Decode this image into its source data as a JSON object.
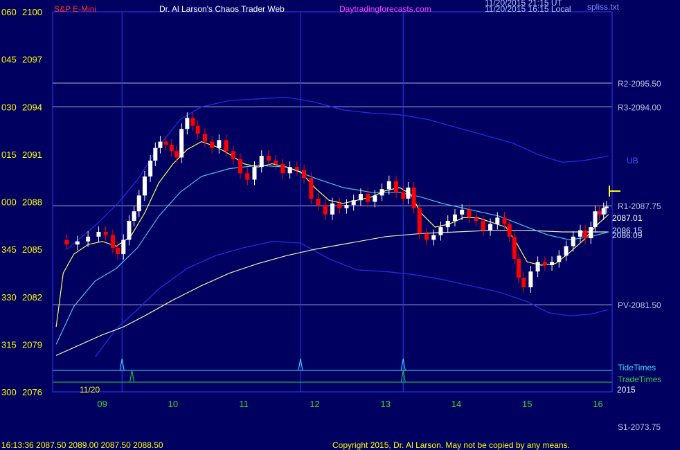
{
  "header": {
    "symbol": "S&P E-Mini",
    "title": "Dr. Al Larson's Chaos Trader Web",
    "site": "Daytradingforecasts.com",
    "stamp1": "11/20/2015 21:15 UT",
    "stamp2": "11/20/2015 16:15 Local",
    "file": "spliss.txt"
  },
  "footer": {
    "quote": "16:13:36  2087.50 2089.00 2087.50 2088.50",
    "copyright": "Copyright 2015, Dr. Al Larson. May not be copied by any means."
  },
  "colors": {
    "background": "#000060",
    "up_candle": "#ffffff",
    "down_candle": "#ff0000",
    "band": "#1f2ee0",
    "cyan_ma": "#48c8e8",
    "yellow_ma": "#ffff60",
    "ivory_ma": "#f0f0b0",
    "level_line": "#b0b0d8",
    "tide": "#40e0ff",
    "trade": "#20d050",
    "axis_text_y": "#ffff00",
    "axis_text_x": "#30e030"
  },
  "chart_data": {
    "type": "candlestick",
    "date_label": "11/20",
    "year_label": "2015",
    "x_hours": [
      "09",
      "10",
      "11",
      "12",
      "13",
      "14",
      "15",
      "16"
    ],
    "xlim": [
      8.3,
      16.2
    ],
    "ylim": [
      2076,
      2100
    ],
    "left_ticks": [
      "060",
      "045",
      "030",
      "015",
      "000",
      "345",
      "330",
      "315",
      "300"
    ],
    "y_ticks": [
      2100,
      2097,
      2094,
      2091,
      2088,
      2085,
      2082,
      2079,
      2076
    ],
    "levels": [
      {
        "label": "R2-2095.50",
        "price": 2095.5
      },
      {
        "label": "R3-2094.00",
        "price": 2094.0
      },
      {
        "label": "R1-2087.75",
        "price": 2087.75
      },
      {
        "label": "PV-2081.50",
        "price": 2081.5
      },
      {
        "label": "S1-2073.75",
        "price": 2073.75
      }
    ],
    "value_labels": [
      {
        "label": "2087.01",
        "price": 2087.01
      },
      {
        "label": "2086.15",
        "price": 2086.15
      },
      {
        "label": "2086.09",
        "price": 2086.09
      }
    ],
    "band_label": "UB",
    "event_rows": [
      {
        "name": "TideTimes",
        "times": [
          9.28,
          11.8,
          13.25
        ]
      },
      {
        "name": "TradeTimes",
        "times": [
          9.42,
          13.25
        ]
      }
    ],
    "vertical_markers": [
      9.28,
      11.8,
      13.25
    ],
    "close_series": [
      [
        8.35,
        2085.6
      ],
      [
        8.5,
        2085.3
      ],
      [
        8.65,
        2085.5
      ],
      [
        8.8,
        2085.8
      ],
      [
        8.95,
        2086.1
      ],
      [
        9.05,
        2085.9
      ],
      [
        9.15,
        2085.1
      ],
      [
        9.22,
        2084.7
      ],
      [
        9.3,
        2085.6
      ],
      [
        9.38,
        2086.8
      ],
      [
        9.45,
        2087.4
      ],
      [
        9.52,
        2088.4
      ],
      [
        9.6,
        2089.6
      ],
      [
        9.68,
        2090.6
      ],
      [
        9.75,
        2091.4
      ],
      [
        9.82,
        2091.8
      ],
      [
        9.9,
        2091.6
      ],
      [
        9.98,
        2091.2
      ],
      [
        10.05,
        2090.8
      ],
      [
        10.12,
        2092.6
      ],
      [
        10.2,
        2093.3
      ],
      [
        10.28,
        2092.8
      ],
      [
        10.35,
        2092.3
      ],
      [
        10.45,
        2091.8
      ],
      [
        10.55,
        2091.4
      ],
      [
        10.65,
        2091.9
      ],
      [
        10.75,
        2091.2
      ],
      [
        10.85,
        2090.7
      ],
      [
        10.95,
        2089.8
      ],
      [
        11.05,
        2089.4
      ],
      [
        11.15,
        2090.2
      ],
      [
        11.25,
        2090.9
      ],
      [
        11.35,
        2090.6
      ],
      [
        11.45,
        2090.4
      ],
      [
        11.55,
        2089.8
      ],
      [
        11.65,
        2090.2
      ],
      [
        11.75,
        2090.0
      ],
      [
        11.85,
        2089.5
      ],
      [
        11.95,
        2088.2
      ],
      [
        12.05,
        2087.8
      ],
      [
        12.15,
        2087.2
      ],
      [
        12.25,
        2087.9
      ],
      [
        12.35,
        2087.6
      ],
      [
        12.45,
        2087.8
      ],
      [
        12.55,
        2088.1
      ],
      [
        12.65,
        2088.5
      ],
      [
        12.75,
        2088.0
      ],
      [
        12.85,
        2088.4
      ],
      [
        12.95,
        2088.8
      ],
      [
        13.05,
        2089.3
      ],
      [
        13.15,
        2088.6
      ],
      [
        13.25,
        2088.2
      ],
      [
        13.32,
        2088.9
      ],
      [
        13.4,
        2087.6
      ],
      [
        13.48,
        2086.0
      ],
      [
        13.58,
        2085.6
      ],
      [
        13.68,
        2085.9
      ],
      [
        13.78,
        2086.4
      ],
      [
        13.88,
        2086.8
      ],
      [
        13.98,
        2087.2
      ],
      [
        14.08,
        2087.5
      ],
      [
        14.18,
        2087.0
      ],
      [
        14.28,
        2086.8
      ],
      [
        14.38,
        2086.2
      ],
      [
        14.48,
        2086.6
      ],
      [
        14.58,
        2087.0
      ],
      [
        14.68,
        2086.6
      ],
      [
        14.75,
        2085.8
      ],
      [
        14.82,
        2084.4
      ],
      [
        14.88,
        2083.2
      ],
      [
        14.95,
        2082.6
      ],
      [
        15.05,
        2083.6
      ],
      [
        15.15,
        2084.2
      ],
      [
        15.25,
        2084.0
      ],
      [
        15.35,
        2084.2
      ],
      [
        15.45,
        2084.6
      ],
      [
        15.55,
        2085.2
      ],
      [
        15.65,
        2085.8
      ],
      [
        15.75,
        2086.2
      ],
      [
        15.82,
        2085.7
      ],
      [
        15.9,
        2086.4
      ],
      [
        15.96,
        2087.4
      ],
      [
        16.02,
        2087.2
      ],
      [
        16.08,
        2087.6
      ],
      [
        16.12,
        2087.7
      ]
    ],
    "ma_fast": [
      [
        8.35,
        2080.1
      ],
      [
        8.45,
        2083.5
      ],
      [
        8.6,
        2084.7
      ],
      [
        8.8,
        2085.3
      ],
      [
        9.0,
        2085.5
      ],
      [
        9.2,
        2085.2
      ],
      [
        9.4,
        2085.8
      ],
      [
        9.6,
        2087.3
      ],
      [
        9.8,
        2089.2
      ],
      [
        10.0,
        2090.4
      ],
      [
        10.2,
        2091.3
      ],
      [
        10.4,
        2091.8
      ],
      [
        10.6,
        2091.5
      ],
      [
        10.8,
        2091.0
      ],
      [
        11.0,
        2090.4
      ],
      [
        11.2,
        2090.2
      ],
      [
        11.4,
        2090.4
      ],
      [
        11.6,
        2090.2
      ],
      [
        11.8,
        2089.9
      ],
      [
        12.0,
        2088.9
      ],
      [
        12.2,
        2088.1
      ],
      [
        12.4,
        2087.9
      ],
      [
        12.6,
        2088.1
      ],
      [
        12.8,
        2088.3
      ],
      [
        13.0,
        2088.7
      ],
      [
        13.2,
        2088.9
      ],
      [
        13.35,
        2088.5
      ],
      [
        13.5,
        2087.3
      ],
      [
        13.7,
        2086.4
      ],
      [
        13.9,
        2086.6
      ],
      [
        14.1,
        2087.0
      ],
      [
        14.3,
        2087.0
      ],
      [
        14.5,
        2086.7
      ],
      [
        14.7,
        2086.4
      ],
      [
        14.85,
        2085.4
      ],
      [
        15.0,
        2084.2
      ],
      [
        15.2,
        2084.0
      ],
      [
        15.4,
        2084.1
      ],
      [
        15.6,
        2084.8
      ],
      [
        15.8,
        2085.6
      ],
      [
        16.0,
        2086.6
      ],
      [
        16.15,
        2087.2
      ]
    ],
    "ma_mid": [
      [
        8.35,
        2079.0
      ],
      [
        8.6,
        2081.4
      ],
      [
        8.9,
        2083.0
      ],
      [
        9.2,
        2083.8
      ],
      [
        9.5,
        2085.1
      ],
      [
        9.8,
        2087.1
      ],
      [
        10.1,
        2088.6
      ],
      [
        10.4,
        2089.6
      ],
      [
        10.8,
        2090.1
      ],
      [
        11.2,
        2090.3
      ],
      [
        11.6,
        2090.2
      ],
      [
        12.0,
        2089.5
      ],
      [
        12.4,
        2088.9
      ],
      [
        12.8,
        2088.6
      ],
      [
        13.2,
        2088.6
      ],
      [
        13.5,
        2088.3
      ],
      [
        13.8,
        2087.9
      ],
      [
        14.2,
        2087.5
      ],
      [
        14.6,
        2087.1
      ],
      [
        15.0,
        2086.4
      ],
      [
        15.3,
        2085.9
      ],
      [
        15.6,
        2085.6
      ],
      [
        15.9,
        2085.8
      ],
      [
        16.15,
        2086.1
      ]
    ],
    "ma_slow": [
      [
        8.35,
        2078.3
      ],
      [
        8.7,
        2079.0
      ],
      [
        9.0,
        2079.6
      ],
      [
        9.3,
        2080.1
      ],
      [
        9.6,
        2080.8
      ],
      [
        10.0,
        2081.8
      ],
      [
        10.4,
        2082.7
      ],
      [
        10.8,
        2083.5
      ],
      [
        11.2,
        2084.1
      ],
      [
        11.6,
        2084.6
      ],
      [
        12.0,
        2085.0
      ],
      [
        12.5,
        2085.4
      ],
      [
        13.0,
        2085.8
      ],
      [
        13.5,
        2086.0
      ],
      [
        14.0,
        2086.1
      ],
      [
        14.5,
        2086.2
      ],
      [
        15.0,
        2086.2
      ],
      [
        15.5,
        2086.1
      ],
      [
        16.0,
        2086.1
      ],
      [
        16.15,
        2086.1
      ]
    ],
    "upper_band": [
      [
        8.5,
        2085.0
      ],
      [
        8.9,
        2086.5
      ],
      [
        9.2,
        2087.8
      ],
      [
        9.5,
        2089.4
      ],
      [
        9.8,
        2091.5
      ],
      [
        10.1,
        2093.2
      ],
      [
        10.4,
        2094.0
      ],
      [
        10.8,
        2094.4
      ],
      [
        11.2,
        2094.5
      ],
      [
        11.6,
        2094.6
      ],
      [
        12.0,
        2094.3
      ],
      [
        12.4,
        2093.8
      ],
      [
        12.8,
        2093.6
      ],
      [
        13.2,
        2093.5
      ],
      [
        13.6,
        2093.2
      ],
      [
        14.0,
        2092.7
      ],
      [
        14.4,
        2092.2
      ],
      [
        14.8,
        2091.7
      ],
      [
        15.2,
        2090.9
      ],
      [
        15.5,
        2090.5
      ],
      [
        15.8,
        2090.6
      ],
      [
        16.15,
        2090.9
      ]
    ],
    "lower_band": [
      [
        8.9,
        2078.2
      ],
      [
        9.2,
        2080.0
      ],
      [
        9.5,
        2081.2
      ],
      [
        9.8,
        2082.5
      ],
      [
        10.2,
        2083.8
      ],
      [
        10.6,
        2084.6
      ],
      [
        11.0,
        2085.1
      ],
      [
        11.4,
        2085.5
      ],
      [
        11.8,
        2085.4
      ],
      [
        12.2,
        2084.4
      ],
      [
        12.6,
        2083.7
      ],
      [
        13.0,
        2083.6
      ],
      [
        13.4,
        2083.4
      ],
      [
        13.8,
        2083.1
      ],
      [
        14.2,
        2082.7
      ],
      [
        14.6,
        2082.3
      ],
      [
        15.0,
        2081.7
      ],
      [
        15.3,
        2081.0
      ],
      [
        15.6,
        2080.8
      ],
      [
        15.9,
        2080.9
      ],
      [
        16.15,
        2081.2
      ]
    ],
    "current_price_marker": 2088.5
  }
}
